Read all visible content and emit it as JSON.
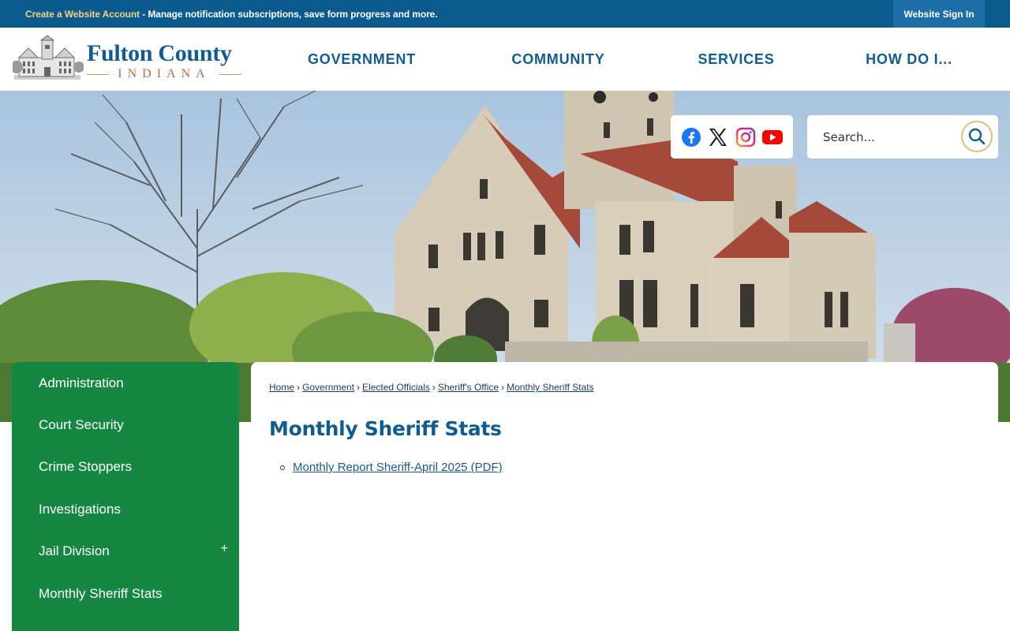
{
  "topbar": {
    "create_account": "Create a Website Account",
    "message": " - Manage notification subscriptions, save form progress and more.",
    "signin": "Website Sign In"
  },
  "logo": {
    "title": "Fulton County",
    "subtitle": "INDIANA"
  },
  "nav": {
    "items": [
      "GOVERNMENT",
      "COMMUNITY",
      "SERVICES",
      "HOW DO I..."
    ]
  },
  "social": {
    "icons": [
      "facebook-icon",
      "x-twitter-icon",
      "instagram-icon",
      "youtube-icon"
    ]
  },
  "search": {
    "placeholder": "Search..."
  },
  "sidebar": {
    "items": [
      {
        "label": "Administration"
      },
      {
        "label": "Court Security"
      },
      {
        "label": "Crime Stoppers"
      },
      {
        "label": "Investigations"
      },
      {
        "label": "Jail Division",
        "expand": "+"
      },
      {
        "label": "Monthly Sheriff Stats"
      }
    ]
  },
  "breadcrumb": [
    "Home",
    "Government",
    "Elected Officials",
    "Sheriff's Office",
    "Monthly Sheriff Stats"
  ],
  "breadcrumb_sep": "›",
  "page": {
    "title": "Monthly Sheriff Stats",
    "documents": [
      "Monthly Report Sheriff-April 2025 (PDF)"
    ]
  },
  "colors": {
    "topbar": "#0b5a8e",
    "brand_blue": "#0f5d90",
    "sidebar_green": "#168743",
    "account_link": "#f2d382"
  }
}
